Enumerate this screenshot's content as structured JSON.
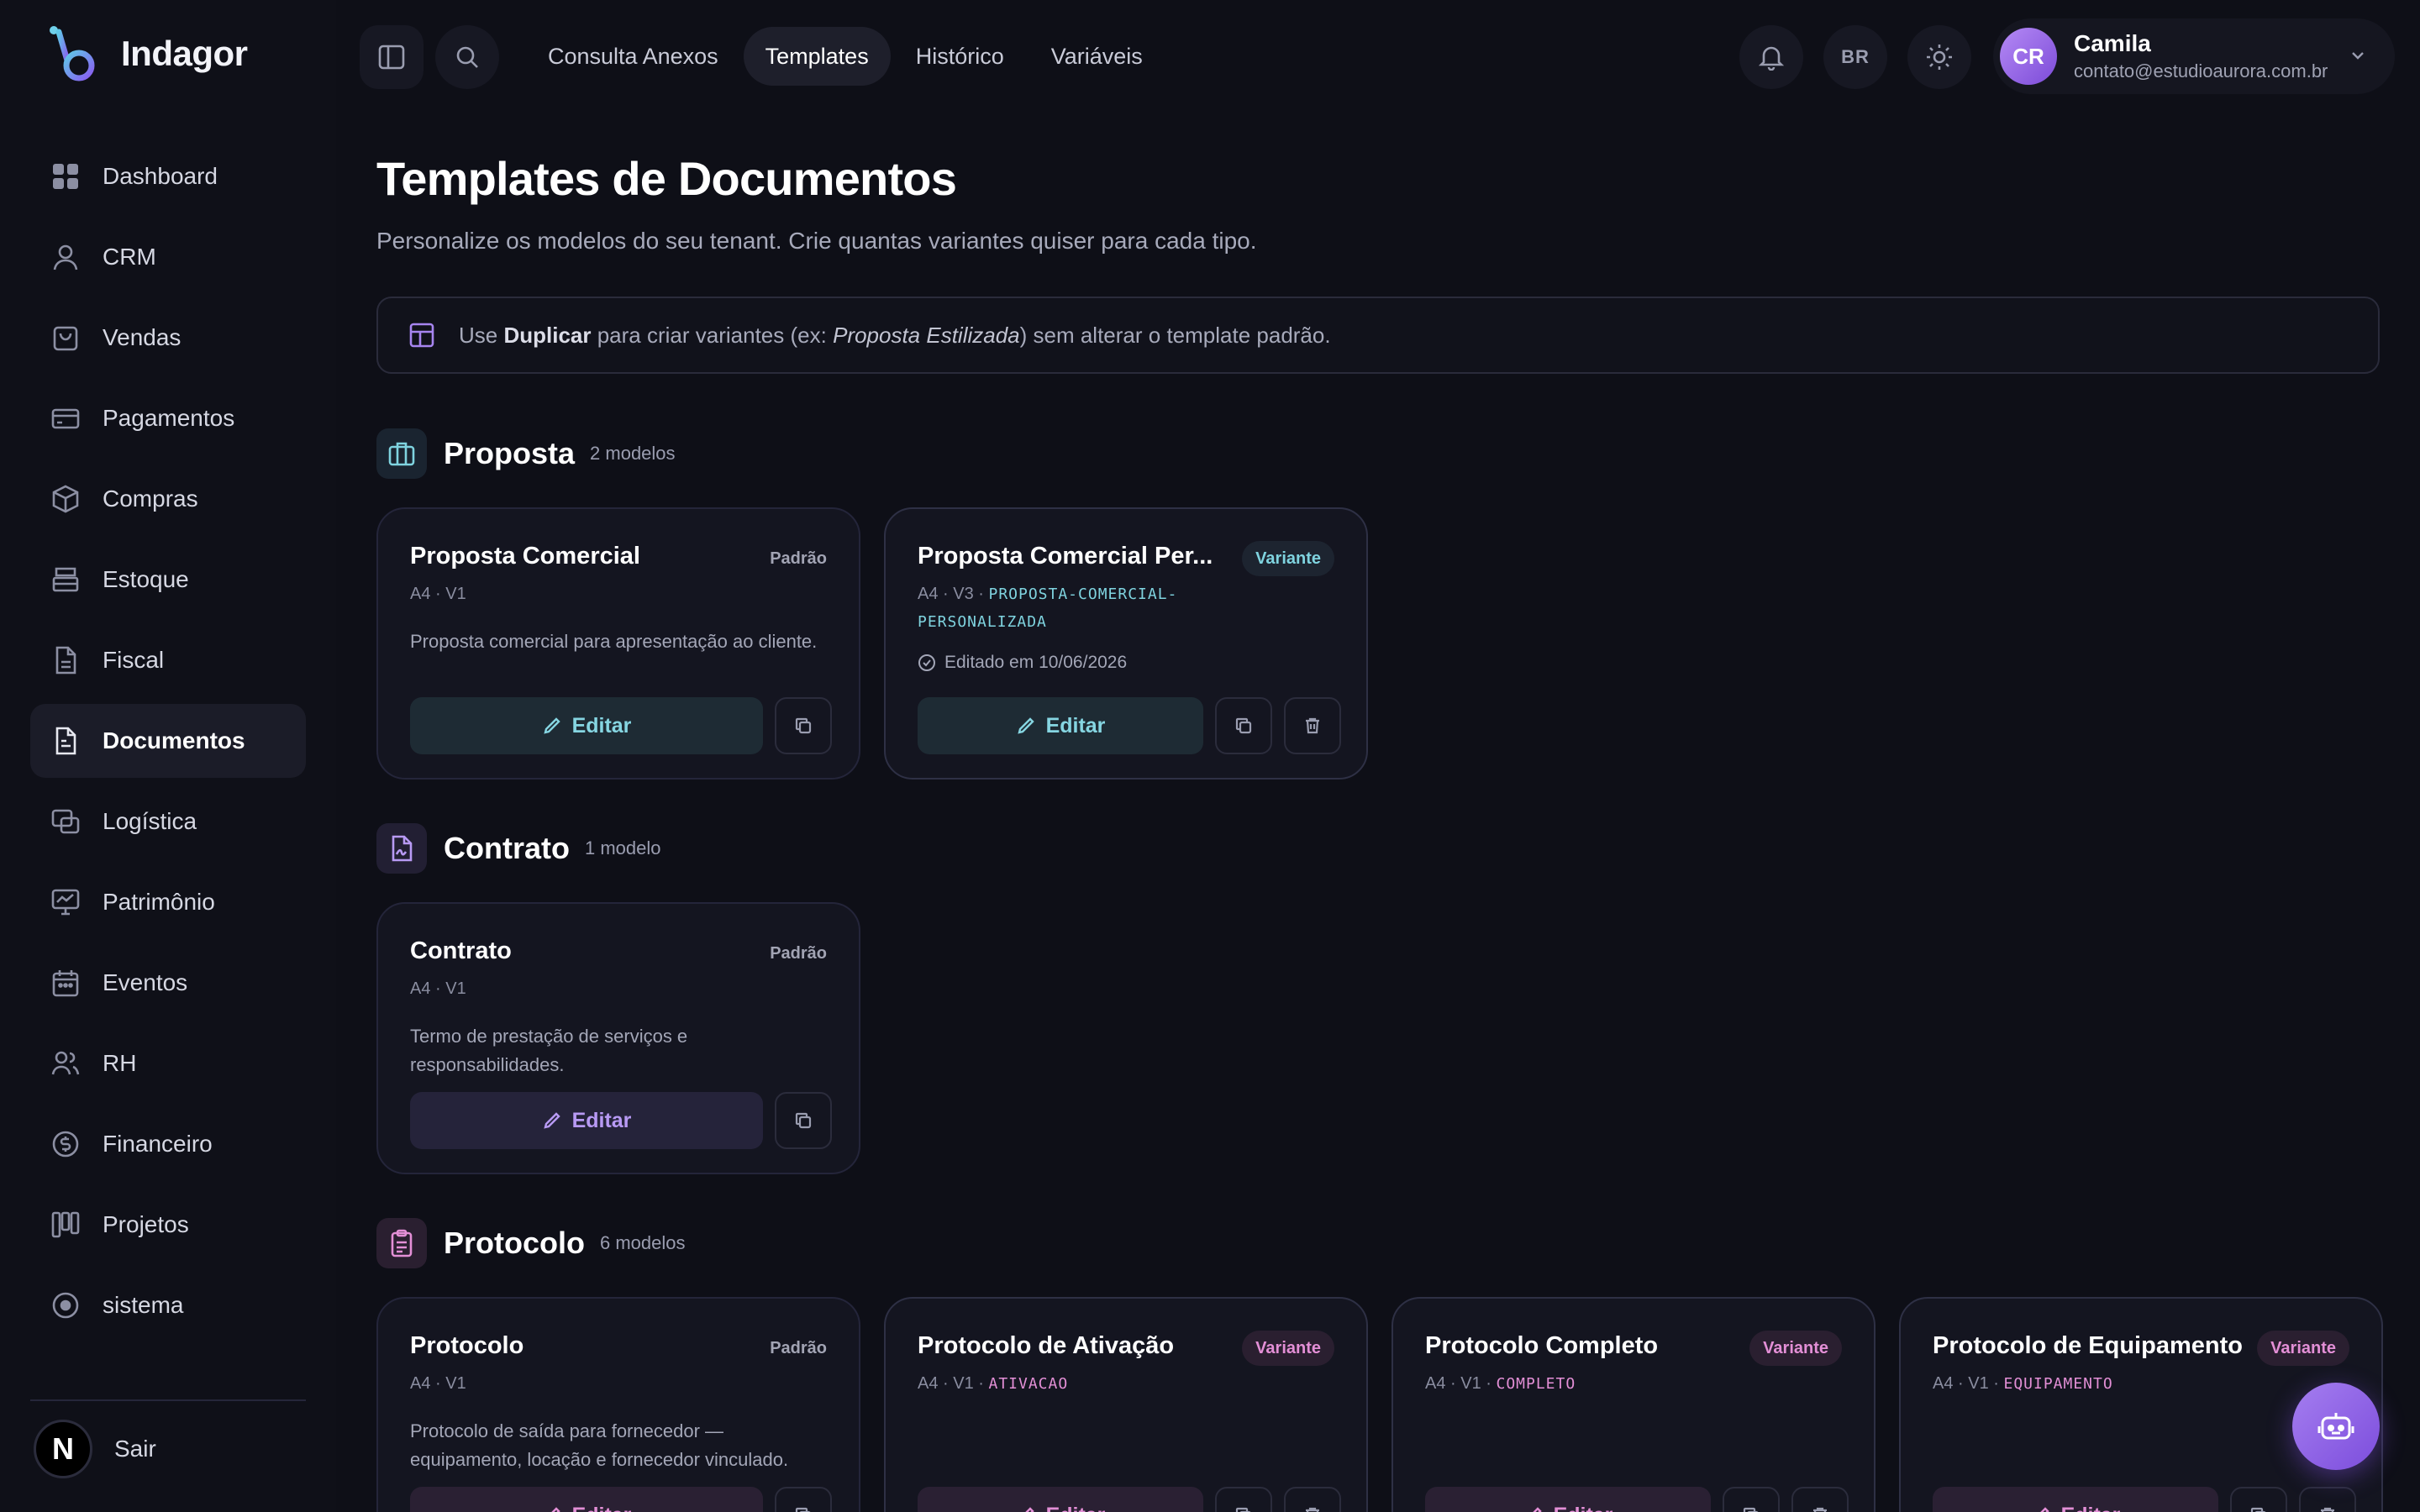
{
  "app": {
    "name": "Indagor"
  },
  "sidebar": {
    "items": [
      {
        "label": "Dashboard",
        "icon": "dashboard-icon"
      },
      {
        "label": "CRM",
        "icon": "user-icon"
      },
      {
        "label": "Vendas",
        "icon": "shopping-bag-icon"
      },
      {
        "label": "Pagamentos",
        "icon": "credit-card-icon"
      },
      {
        "label": "Compras",
        "icon": "box-icon"
      },
      {
        "label": "Estoque",
        "icon": "archive-icon"
      },
      {
        "label": "Fiscal",
        "icon": "file-icon"
      },
      {
        "label": "Documentos",
        "icon": "document-icon",
        "active": true
      },
      {
        "label": "Logística",
        "icon": "truck-icon"
      },
      {
        "label": "Patrimônio",
        "icon": "monitor-icon"
      },
      {
        "label": "Eventos",
        "icon": "calendar-icon"
      },
      {
        "label": "RH",
        "icon": "users-icon"
      },
      {
        "label": "Financeiro",
        "icon": "coin-icon"
      },
      {
        "label": "Projetos",
        "icon": "kanban-icon"
      },
      {
        "label": "sistema",
        "icon": "circle-icon"
      }
    ],
    "logout": {
      "label": "Sair",
      "avatar_letter": "N"
    }
  },
  "topbar": {
    "tabs": [
      {
        "label": "Consulta Anexos"
      },
      {
        "label": "Templates",
        "active": true
      },
      {
        "label": "Histórico"
      },
      {
        "label": "Variáveis"
      }
    ],
    "locale": "BR",
    "user": {
      "initials": "CR",
      "name": "Camila",
      "email": "contato@estudioaurora.com.br"
    }
  },
  "page": {
    "title": "Templates de Documentos",
    "subtitle": "Personalize os modelos do seu tenant. Crie quantas variantes quiser para cada tipo.",
    "tip": {
      "prefix": "Use ",
      "bold": "Duplicar",
      "middle": " para criar variantes (ex: ",
      "italic": "Proposta Estilizada",
      "suffix": ") sem alterar o template padrão."
    }
  },
  "sections": [
    {
      "title": "Proposta",
      "count": "2 modelos",
      "accent": "#7fd3df",
      "cards": [
        {
          "title": "Proposta Comercial",
          "badge": "Padrão",
          "meta": "A4 · V1",
          "desc": "Proposta comercial para apresentação ao cliente.",
          "edit": "Editar"
        },
        {
          "title": "Proposta Comercial Per...",
          "badge": "Variante",
          "meta": "A4 · V3 · ",
          "slug_line1": "PROPOSTA-COMERCIAL-",
          "slug_line2": "PERSONALIZADA",
          "edited": "Editado em 10/06/2026",
          "edit": "Editar"
        }
      ]
    },
    {
      "title": "Contrato",
      "count": "1 modelo",
      "accent": "#b89af4",
      "cards": [
        {
          "title": "Contrato",
          "badge": "Padrão",
          "meta": "A4 · V1",
          "desc_line1": "Termo de prestação de serviços e",
          "desc_line2": "responsabilidades.",
          "edit": "Editar"
        }
      ]
    },
    {
      "title": "Protocolo",
      "count": "6 modelos",
      "accent": "#e38fd6",
      "cards": [
        {
          "title": "Protocolo",
          "badge": "Padrão",
          "meta": "A4 · V1",
          "desc_line1": "Protocolo de saída para fornecedor —",
          "desc_line2": "equipamento, locação e fornecedor vinculado.",
          "edit": "Editar"
        },
        {
          "title": "Protocolo de Ativação",
          "badge": "Variante",
          "meta": "A4 · V1 · ",
          "slug": "ATIVACAO",
          "edit": "Editar"
        },
        {
          "title": "Protocolo Completo",
          "badge": "Variante",
          "meta": "A4 · V1 · ",
          "slug": "COMPLETO",
          "edit": "Editar"
        },
        {
          "title": "Protocolo de Equipamento",
          "badge": "Variante",
          "meta": "A4 · V1 · ",
          "slug": "EQUIPAMENTO",
          "edit": "Editar"
        }
      ]
    }
  ]
}
